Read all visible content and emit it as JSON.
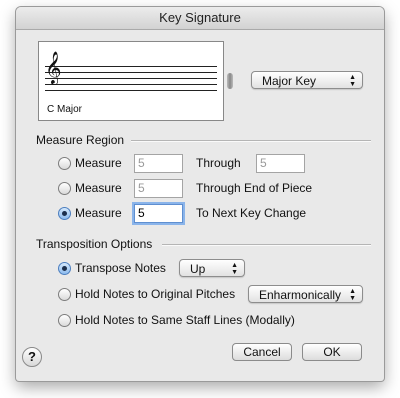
{
  "window": {
    "title": "Key Signature"
  },
  "preview": {
    "clef_glyph": "𝄞",
    "key_label": "C Major"
  },
  "key_mode": {
    "selected": "Major Key"
  },
  "measure_region": {
    "title": "Measure Region",
    "rows": [
      {
        "label": "Measure",
        "value": "5",
        "middle": "Through",
        "end_value": "5",
        "selected": false
      },
      {
        "label": "Measure",
        "value": "5",
        "middle": "Through End of Piece",
        "selected": false
      },
      {
        "label": "Measure",
        "value": "5",
        "middle": "To Next Key Change",
        "selected": true
      }
    ]
  },
  "transposition": {
    "title": "Transposition Options",
    "transpose_label": "Transpose Notes",
    "transpose_direction": "Up",
    "hold_label": "Hold Notes to Original Pitches",
    "hold_option": "Enharmonically",
    "same_lines_label": "Hold Notes to Same Staff Lines (Modally)",
    "selected": "transpose"
  },
  "buttons": {
    "help": "?",
    "cancel": "Cancel",
    "ok": "OK"
  }
}
